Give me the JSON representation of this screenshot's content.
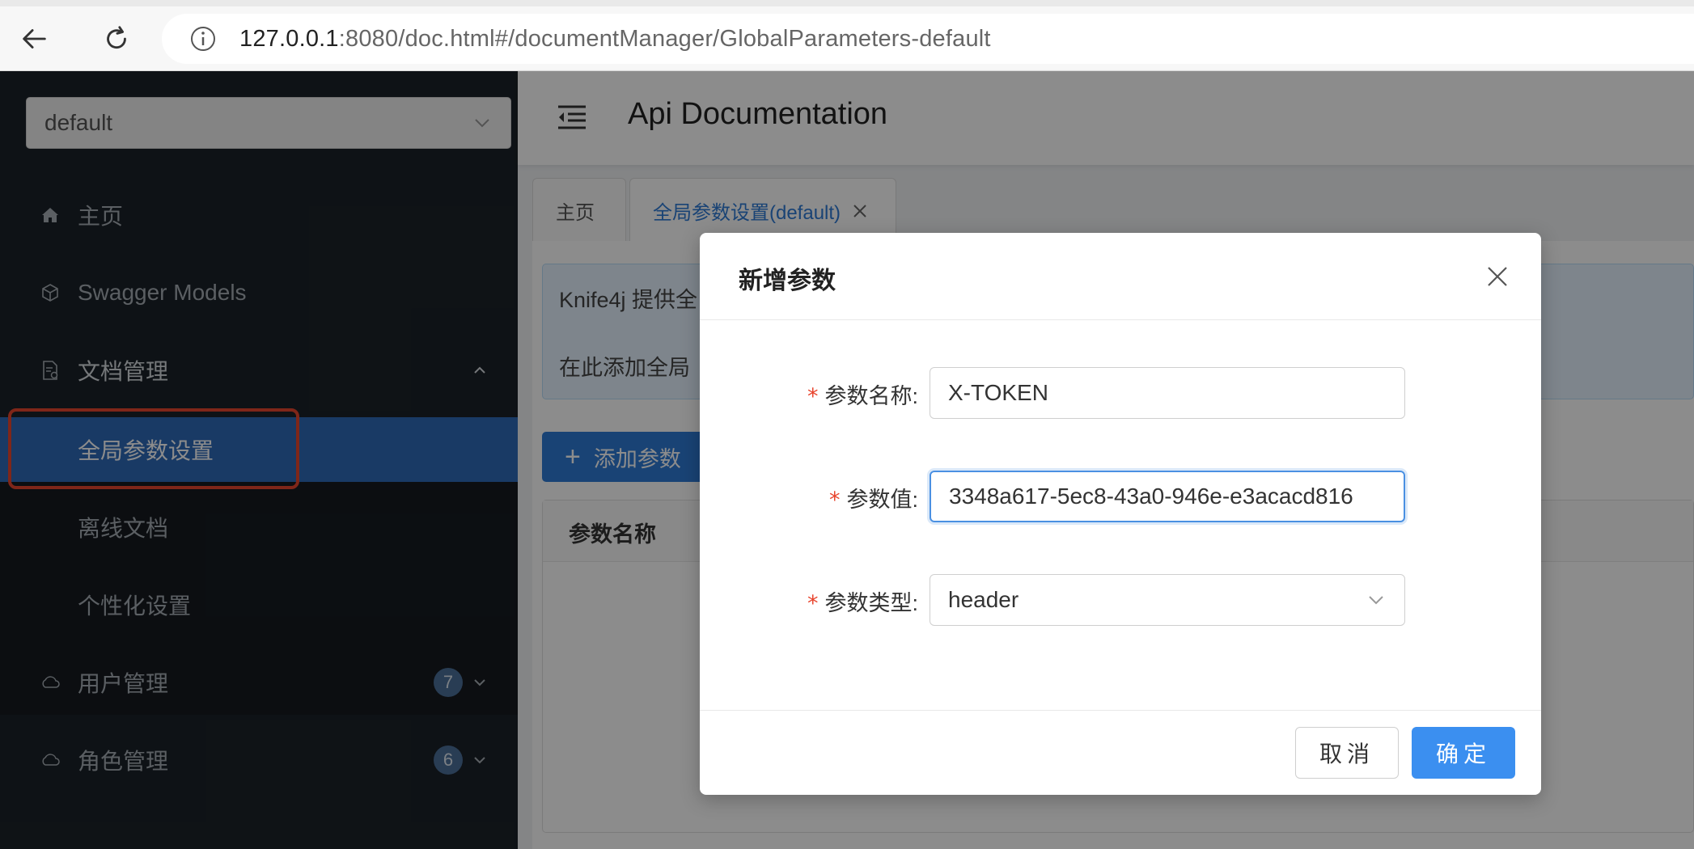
{
  "browser": {
    "url_host": "127.0.0.1",
    "url_rest": ":8080/doc.html#/documentManager/GlobalParameters-default"
  },
  "sidebar": {
    "group_select": "default",
    "items": [
      {
        "label": "主页",
        "icon": "home-icon"
      },
      {
        "label": "Swagger Models",
        "icon": "cube-icon"
      },
      {
        "label": "文档管理",
        "icon": "document-gear-icon"
      },
      {
        "label": "全局参数设置"
      },
      {
        "label": "离线文档"
      },
      {
        "label": "个性化设置"
      },
      {
        "label": "用户管理",
        "icon": "cloud-icon",
        "badge": "7"
      },
      {
        "label": "角色管理",
        "icon": "cloud-icon",
        "badge": "6"
      }
    ],
    "active_color": "#2f6ab8",
    "highlight_color": "#e8452e"
  },
  "header": {
    "title": "Api Documentation"
  },
  "tabs": [
    {
      "label": "主页"
    },
    {
      "label": "全局参数设置(default)"
    }
  ],
  "content": {
    "alert_line1": "Knife4j 提供全",
    "alert_line2": "在此添加全局",
    "add_button": "添加参数",
    "table_header": "参数名称"
  },
  "modal": {
    "title": "新增参数",
    "fields": [
      {
        "label": "参数名称:",
        "value": "X-TOKEN"
      },
      {
        "label": "参数值:",
        "value": "3348a617-5ec8-43a0-946e-e3acacd816"
      },
      {
        "label": "参数类型:",
        "value": "header"
      }
    ],
    "cancel": "取消",
    "ok": "确定",
    "primary_color": "#3b8ff0"
  }
}
